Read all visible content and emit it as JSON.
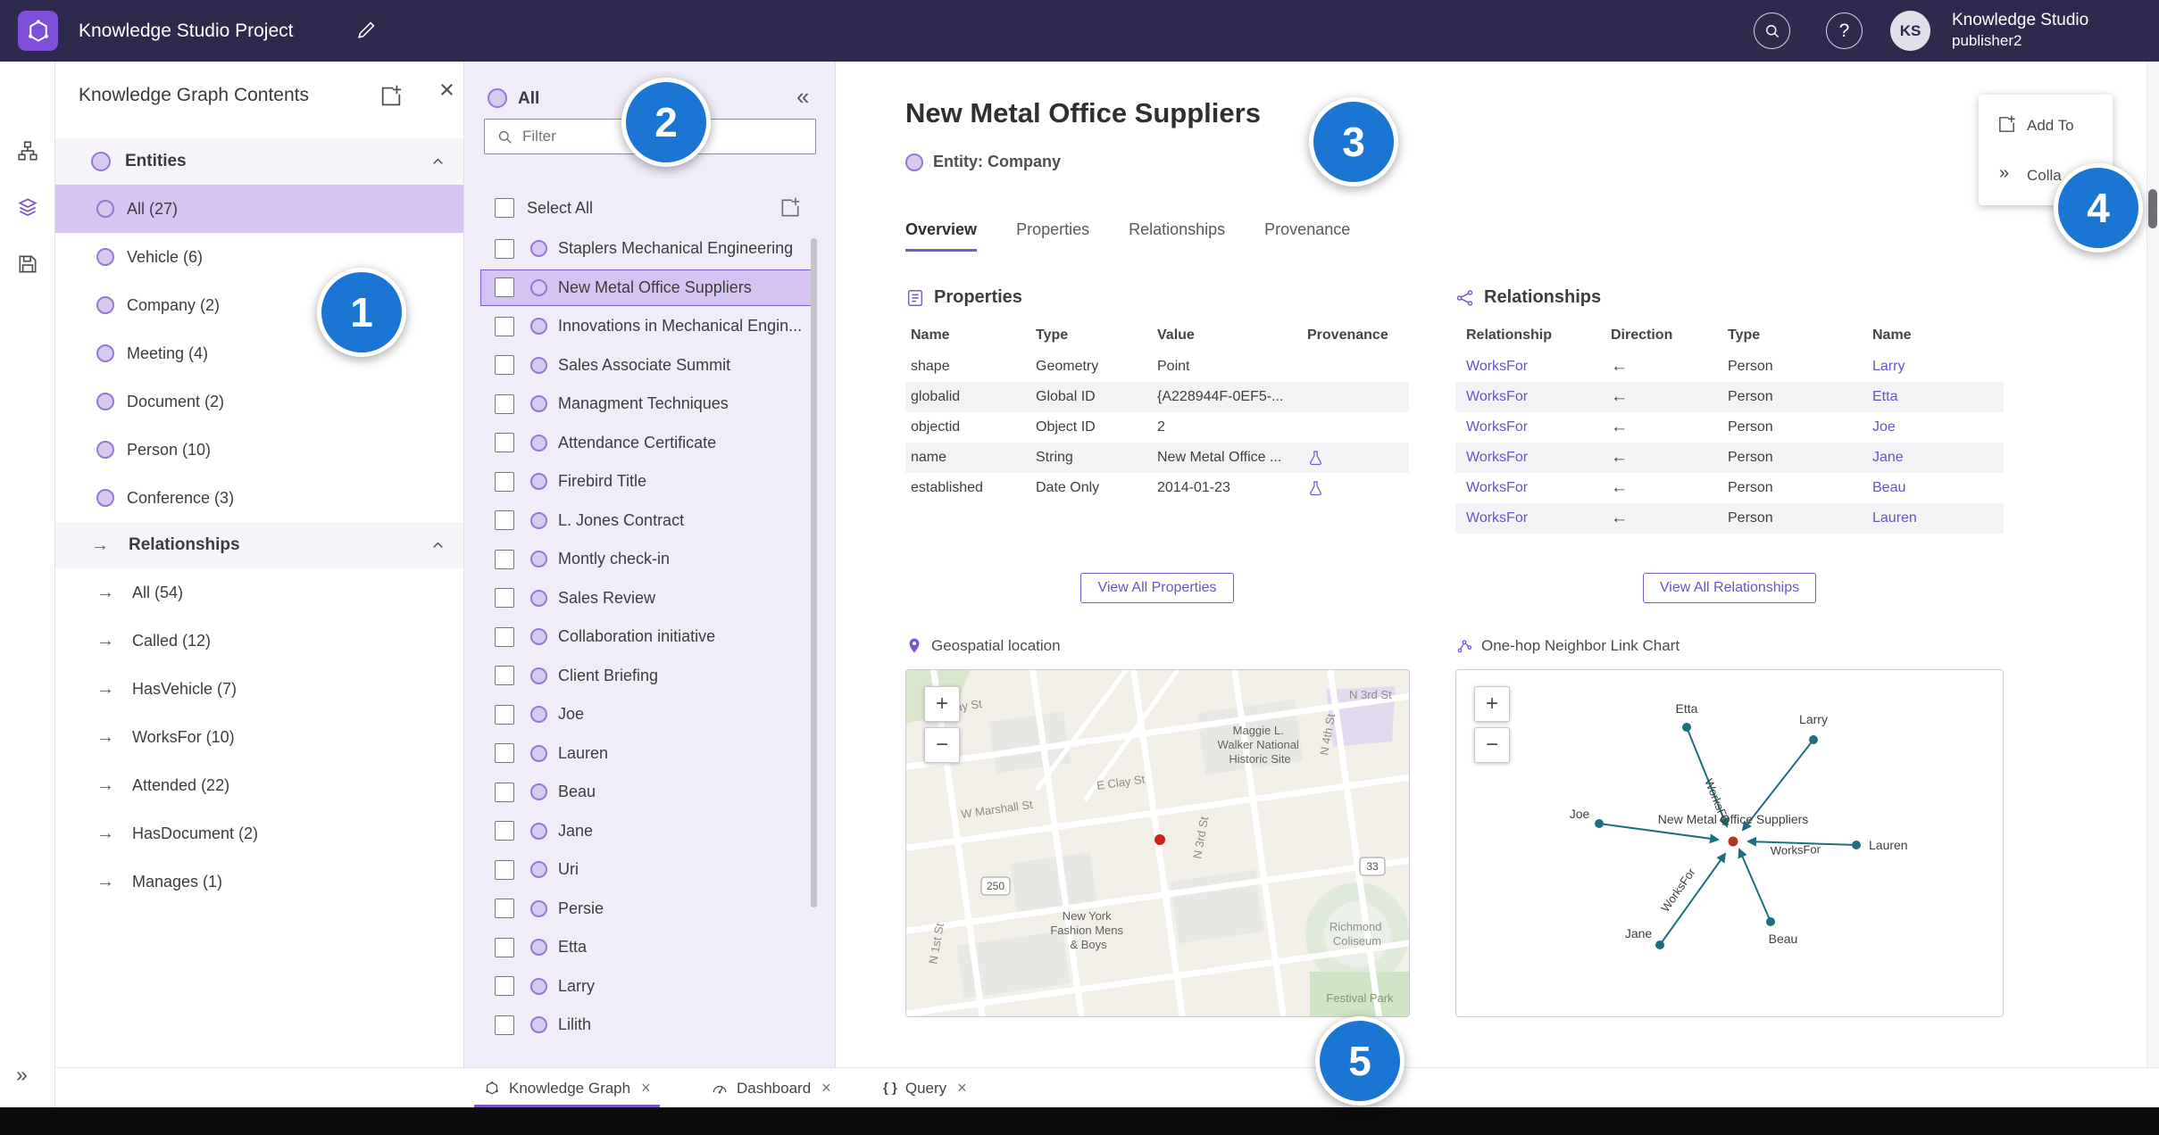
{
  "topbar": {
    "title": "Knowledge Studio Project",
    "user_name": "Knowledge Studio",
    "user_role": "publisher2",
    "avatar_initials": "KS"
  },
  "contents_panel": {
    "title": "Knowledge Graph Contents",
    "entities": {
      "label": "Entities",
      "items": [
        {
          "label": "All (27)",
          "selected": true
        },
        {
          "label": "Vehicle (6)"
        },
        {
          "label": "Company (2)"
        },
        {
          "label": "Meeting (4)"
        },
        {
          "label": "Document (2)"
        },
        {
          "label": "Person (10)"
        },
        {
          "label": "Conference (3)"
        }
      ]
    },
    "relationships": {
      "label": "Relationships",
      "items": [
        {
          "label": "All (54)"
        },
        {
          "label": "Called (12)"
        },
        {
          "label": "HasVehicle (7)"
        },
        {
          "label": "WorksFor (10)"
        },
        {
          "label": "Attended (22)"
        },
        {
          "label": "HasDocument (2)"
        },
        {
          "label": "Manages (1)"
        }
      ]
    }
  },
  "list_panel": {
    "title": "All",
    "filter_placeholder": "Filter",
    "select_all_label": "Select All",
    "items": [
      {
        "label": "Staplers Mechanical Engineering"
      },
      {
        "label": "New Metal Office Suppliers",
        "selected": true
      },
      {
        "label": "Innovations in Mechanical Engin..."
      },
      {
        "label": "Sales Associate Summit"
      },
      {
        "label": "Managment Techniques"
      },
      {
        "label": "Attendance Certificate"
      },
      {
        "label": "Firebird Title"
      },
      {
        "label": "L. Jones Contract"
      },
      {
        "label": "Montly check-in"
      },
      {
        "label": "Sales Review"
      },
      {
        "label": "Collaboration initiative"
      },
      {
        "label": "Client Briefing"
      },
      {
        "label": "Joe"
      },
      {
        "label": "Lauren"
      },
      {
        "label": "Beau"
      },
      {
        "label": "Jane"
      },
      {
        "label": "Uri"
      },
      {
        "label": "Persie"
      },
      {
        "label": "Etta"
      },
      {
        "label": "Larry"
      },
      {
        "label": "Lilith"
      }
    ]
  },
  "detail": {
    "title": "New Metal Office Suppliers",
    "entity_label": "Entity: Company",
    "tabs": [
      "Overview",
      "Properties",
      "Relationships",
      "Provenance"
    ],
    "active_tab": 0,
    "properties": {
      "heading": "Properties",
      "columns": [
        "Name",
        "Type",
        "Value",
        "Provenance"
      ],
      "rows": [
        {
          "name": "shape",
          "type": "Geometry",
          "value": "Point",
          "provenance": false
        },
        {
          "name": "globalid",
          "type": "Global ID",
          "value": "{A228944F-0EF5-...",
          "provenance": false
        },
        {
          "name": "objectid",
          "type": "Object ID",
          "value": "2",
          "provenance": false
        },
        {
          "name": "name",
          "type": "String",
          "value": "New Metal Office ...",
          "provenance": true
        },
        {
          "name": "established",
          "type": "Date Only",
          "value": "2014-01-23",
          "provenance": true
        }
      ],
      "view_all": "View All Properties"
    },
    "relationships": {
      "heading": "Relationships",
      "columns": [
        "Relationship",
        "Direction",
        "Type",
        "Name"
      ],
      "rows": [
        {
          "relationship": "WorksFor",
          "direction": "←",
          "type": "Person",
          "name": "Larry"
        },
        {
          "relationship": "WorksFor",
          "direction": "←",
          "type": "Person",
          "name": "Etta"
        },
        {
          "relationship": "WorksFor",
          "direction": "←",
          "type": "Person",
          "name": "Joe"
        },
        {
          "relationship": "WorksFor",
          "direction": "←",
          "type": "Person",
          "name": "Jane"
        },
        {
          "relationship": "WorksFor",
          "direction": "←",
          "type": "Person",
          "name": "Beau"
        },
        {
          "relationship": "WorksFor",
          "direction": "←",
          "type": "Person",
          "name": "Lauren"
        }
      ],
      "view_all": "View All Relationships"
    },
    "map": {
      "heading": "Geospatial location",
      "streets": {
        "wclay": "W Clay St",
        "eclay": "E Clay St",
        "marshall": "W Marshall St",
        "n1st": "N 1st St",
        "n3rd": "N 3rd St",
        "n4th": "N 4th St"
      },
      "shields": [
        "250",
        "33"
      ],
      "pois": {
        "maggie": [
          "Maggie L.",
          "Walker National",
          "Historic Site"
        ],
        "fashion": [
          "New York",
          "Fashion Mens",
          "& Boys"
        ],
        "coliseum": [
          "Richmond",
          "Coliseum"
        ],
        "festival": "Festival Park"
      },
      "zoom_in": "+",
      "zoom_out": "−"
    },
    "linkchart": {
      "heading": "One-hop Neighbor Link Chart",
      "center_label": "New Metal Office Suppliers",
      "edge_label": "WorksFor",
      "nodes": [
        "Etta",
        "Larry",
        "Joe",
        "Jane",
        "Beau",
        "Lauren"
      ],
      "zoom_in": "+",
      "zoom_out": "−"
    },
    "float_menu": {
      "add_to": "Add To",
      "collapse": "Colla"
    }
  },
  "bottom_tabs": [
    {
      "label": "Knowledge Graph",
      "active": true
    },
    {
      "label": "Dashboard",
      "active": false
    },
    {
      "label": "Query",
      "active": false
    }
  ],
  "badges": [
    "1",
    "2",
    "3",
    "4",
    "5"
  ]
}
